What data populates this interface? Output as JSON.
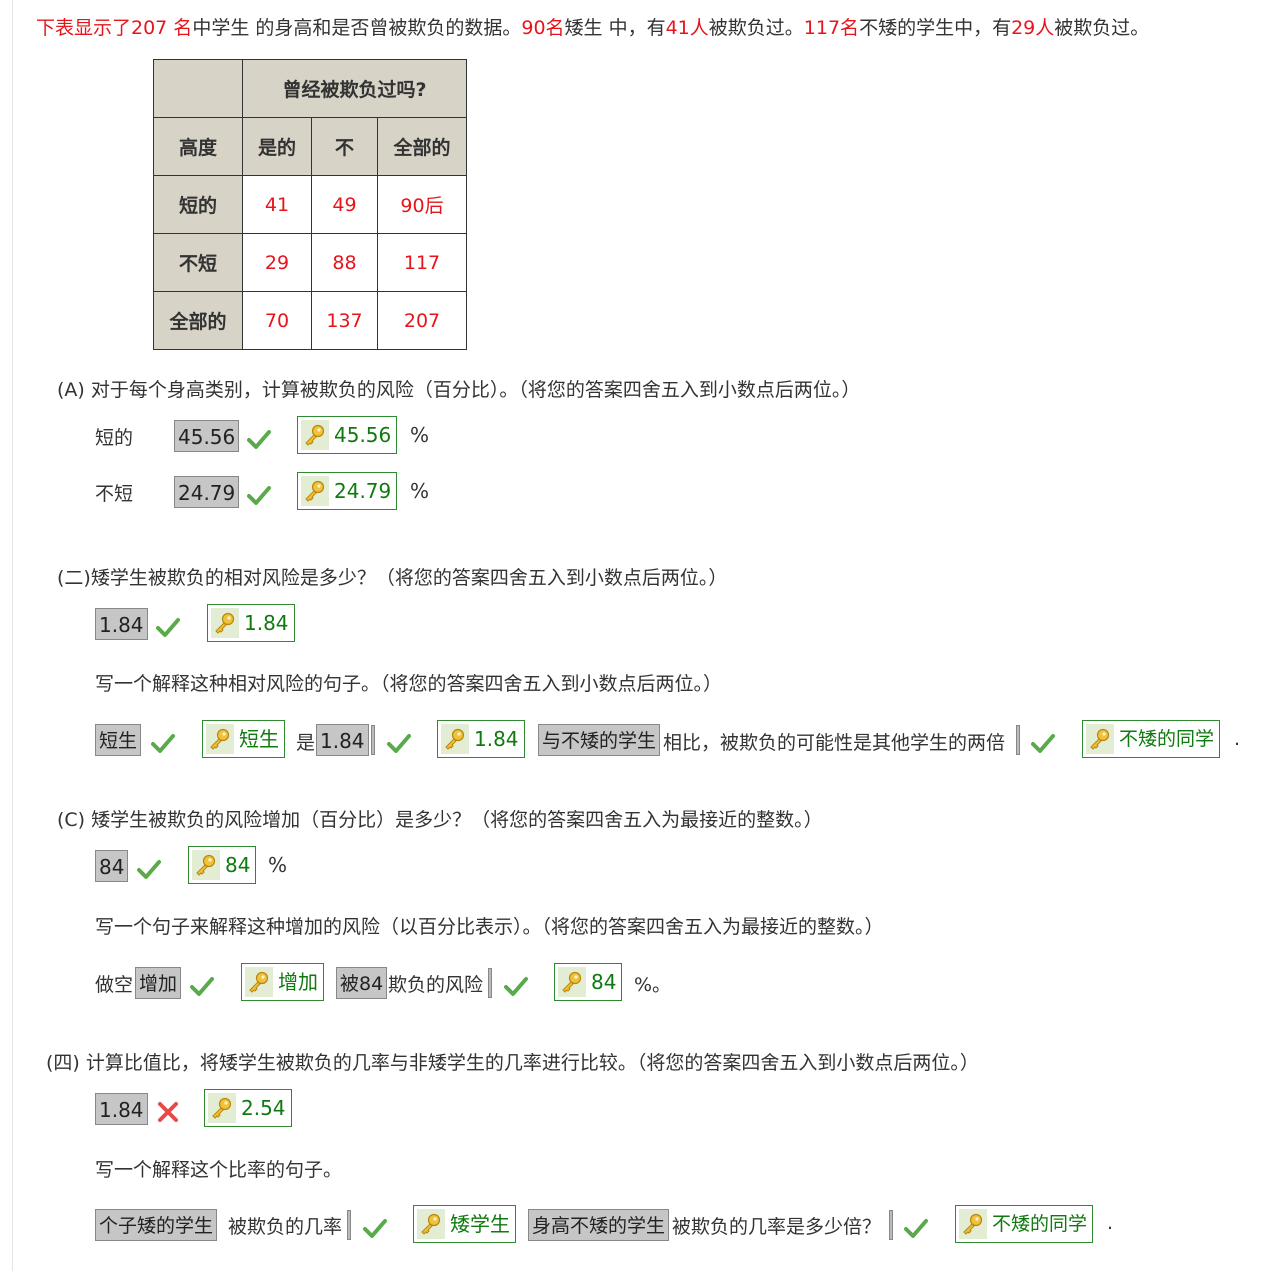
{
  "intro": {
    "p1": "下表显示了207 名",
    "p2": "中学生 的身高和是否曾被欺负的数据。",
    "p3": "90名",
    "p4": "矮生 中，有",
    "p5": "41人",
    "p6": "被欺负过。",
    "p7": "117名",
    "p8": "不矮的学生中，有",
    "p9": "29人",
    "p10": "被欺负过。"
  },
  "table": {
    "header_group": "曾经被欺负过吗?",
    "col_height": "高度",
    "col_yes": "是的",
    "col_no": "不",
    "col_total": "全部的",
    "rows": [
      {
        "label": "短的",
        "yes": "41",
        "no": "49",
        "total": "90后"
      },
      {
        "label": "不短",
        "yes": "29",
        "no": "88",
        "total": "117"
      },
      {
        "label": "全部的",
        "yes": "70",
        "no": "137",
        "total": "207"
      }
    ]
  },
  "qa": {
    "question": "(A) 对于每个身高类别，计算被欺负的风险（百分比）。（将您的答案四舍五入到小数点后两位。）",
    "short_label": "短的",
    "short_answer": "45.56",
    "short_key": "45.56",
    "notshort_label": "不短",
    "notshort_answer": "24.79",
    "notshort_key": "24.79",
    "unit": "%"
  },
  "qb": {
    "question": "(二)矮学生被欺负的相对风险是多少？（将您的答案四舍五入到小数点后两位。）",
    "answer": "1.84",
    "key": "1.84",
    "sentence_prompt": "写一个解释这种相对风险的句子。（将您的答案四舍五入到小数点后两位。）",
    "s_ans1": "短生",
    "s_key1": "短生",
    "s_text1": "是",
    "s_ans2": "1.84",
    "s_key2": "1.84",
    "s_ans3": "与不矮的学生",
    "s_text2": "相比，被欺负的可能性是其他学生的两倍",
    "s_key3": "不矮的同学",
    "s_end": "."
  },
  "qc": {
    "question": "(C) 矮学生被欺负的风险增加（百分比）是多少？（将您的答案四舍五入为最接近的整数。）",
    "answer": "84",
    "key": "84",
    "unit": "%",
    "sentence_prompt": "写一个句子来解释这种增加的风险（以百分比表示）。（将您的答案四舍五入为最接近的整数。）",
    "s_text1": "做空",
    "s_ans1": "增加",
    "s_key1": "增加",
    "s_ans2": "被84",
    "s_text2": "欺负的风险",
    "s_key2": "84",
    "s_end": "%。"
  },
  "qd": {
    "question": "(四) 计算比值比，将矮学生被欺负的几率与非矮学生的几率进行比较。（将您的答案四舍五入到小数点后两位。）",
    "answer": "1.84",
    "key": "2.54",
    "sentence_prompt": "写一个解释这个比率的句子。",
    "s_ans1": "个子矮的学生",
    "s_text1": "被欺负的几率",
    "s_key1": "矮学生",
    "s_ans2": "身高不矮的学生",
    "s_text2": "被欺负的几率是多少倍？",
    "s_key2": "不矮的同学",
    "s_end": "."
  },
  "colors": {
    "highlight": "#e8141b",
    "correct": "#5aa94b",
    "wrong": "#e84a4a",
    "key_border": "#2f8a2f"
  }
}
